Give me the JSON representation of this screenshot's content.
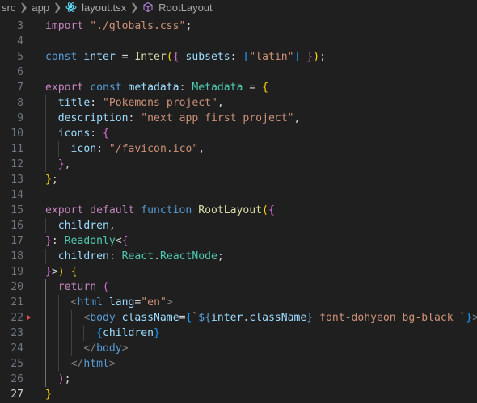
{
  "breadcrumb": {
    "items": [
      "src",
      "app",
      "layout.tsx",
      "RootLayout"
    ],
    "icons": [
      "chevron-right-icon",
      "react-icon",
      "symbol-method-icon"
    ]
  },
  "editor": {
    "active_line": "27",
    "lines": [
      {
        "n": "3",
        "tokens": [
          [
            "ctl",
            "import "
          ],
          [
            "str",
            "\"./globals.css\""
          ],
          [
            "txt",
            ";"
          ]
        ]
      },
      {
        "n": "4",
        "tokens": []
      },
      {
        "n": "5",
        "tokens": [
          [
            "kw",
            "const "
          ],
          [
            "var",
            "inter"
          ],
          [
            "txt",
            " = "
          ],
          [
            "fn",
            "Inter"
          ],
          [
            "b1",
            "("
          ],
          [
            "b2",
            "{"
          ],
          [
            "txt",
            " "
          ],
          [
            "var",
            "subsets"
          ],
          [
            "txt",
            ": "
          ],
          [
            "b3",
            "["
          ],
          [
            "str",
            "\"latin\""
          ],
          [
            "b3",
            "]"
          ],
          [
            "txt",
            " "
          ],
          [
            "b2",
            "}"
          ],
          [
            "b1",
            ")"
          ],
          [
            "txt",
            ";"
          ]
        ]
      },
      {
        "n": "6",
        "tokens": []
      },
      {
        "n": "7",
        "tokens": [
          [
            "ctl",
            "export "
          ],
          [
            "kw",
            "const "
          ],
          [
            "var",
            "metadata"
          ],
          [
            "txt",
            ": "
          ],
          [
            "cls",
            "Metadata"
          ],
          [
            "txt",
            " = "
          ],
          [
            "b1",
            "{"
          ]
        ]
      },
      {
        "n": "8",
        "tokens": [
          [
            "txt",
            "  "
          ],
          [
            "var",
            "title"
          ],
          [
            "txt",
            ": "
          ],
          [
            "str",
            "\"Pokemons project\""
          ],
          [
            "txt",
            ","
          ]
        ]
      },
      {
        "n": "9",
        "tokens": [
          [
            "txt",
            "  "
          ],
          [
            "var",
            "description"
          ],
          [
            "txt",
            ": "
          ],
          [
            "str",
            "\"next app first project\""
          ],
          [
            "txt",
            ","
          ]
        ]
      },
      {
        "n": "10",
        "tokens": [
          [
            "txt",
            "  "
          ],
          [
            "var",
            "icons"
          ],
          [
            "txt",
            ": "
          ],
          [
            "b2",
            "{"
          ]
        ]
      },
      {
        "n": "11",
        "tokens": [
          [
            "txt",
            "    "
          ],
          [
            "var",
            "icon"
          ],
          [
            "txt",
            ": "
          ],
          [
            "str",
            "\"/favicon.ico\""
          ],
          [
            "txt",
            ","
          ]
        ]
      },
      {
        "n": "12",
        "tokens": [
          [
            "txt",
            "  "
          ],
          [
            "b2",
            "}"
          ],
          [
            "txt",
            ","
          ]
        ]
      },
      {
        "n": "13",
        "tokens": [
          [
            "b1",
            "}"
          ],
          [
            "txt",
            ";"
          ]
        ]
      },
      {
        "n": "14",
        "tokens": []
      },
      {
        "n": "15",
        "tokens": [
          [
            "ctl",
            "export default "
          ],
          [
            "kw",
            "function "
          ],
          [
            "fn",
            "RootLayout"
          ],
          [
            "b1",
            "("
          ],
          [
            "b2",
            "{"
          ]
        ]
      },
      {
        "n": "16",
        "tokens": [
          [
            "txt",
            "  "
          ],
          [
            "var",
            "children"
          ],
          [
            "txt",
            ","
          ]
        ]
      },
      {
        "n": "17",
        "tokens": [
          [
            "b2",
            "}"
          ],
          [
            "txt",
            ": "
          ],
          [
            "cls",
            "Readonly"
          ],
          [
            "txt",
            "<"
          ],
          [
            "b2",
            "{"
          ]
        ]
      },
      {
        "n": "18",
        "tokens": [
          [
            "txt",
            "  "
          ],
          [
            "var",
            "children"
          ],
          [
            "txt",
            ": "
          ],
          [
            "cls",
            "React"
          ],
          [
            "txt",
            "."
          ],
          [
            "cls",
            "ReactNode"
          ],
          [
            "txt",
            ";"
          ]
        ]
      },
      {
        "n": "19",
        "tokens": [
          [
            "b2",
            "}"
          ],
          [
            "txt",
            ">"
          ],
          [
            "b1",
            ")"
          ],
          [
            "txt",
            " "
          ],
          [
            "b1",
            "{"
          ]
        ]
      },
      {
        "n": "20",
        "tokens": [
          [
            "txt",
            "  "
          ],
          [
            "ctl",
            "return "
          ],
          [
            "b2",
            "("
          ]
        ]
      },
      {
        "n": "21",
        "tokens": [
          [
            "txt",
            "    "
          ],
          [
            "ang",
            "<"
          ],
          [
            "tag",
            "html "
          ],
          [
            "var",
            "lang"
          ],
          [
            "txt",
            "="
          ],
          [
            "str",
            "\"en\""
          ],
          [
            "ang",
            ">"
          ]
        ]
      },
      {
        "n": "22",
        "tokens": [
          [
            "txt",
            "      "
          ],
          [
            "ang",
            "<"
          ],
          [
            "tag",
            "body "
          ],
          [
            "var",
            "className"
          ],
          [
            "txt",
            "="
          ],
          [
            "b3",
            "{"
          ],
          [
            "str",
            "`"
          ],
          [
            "kw",
            "${"
          ],
          [
            "var",
            "inter"
          ],
          [
            "txt",
            "."
          ],
          [
            "var",
            "className"
          ],
          [
            "kw",
            "}"
          ],
          [
            "str",
            " font-dohyeon bg-black `"
          ],
          [
            "b3",
            "}"
          ],
          [
            "ang",
            ">"
          ]
        ]
      },
      {
        "n": "23",
        "tokens": [
          [
            "txt",
            "        "
          ],
          [
            "b3",
            "{"
          ],
          [
            "var",
            "children"
          ],
          [
            "b3",
            "}"
          ]
        ]
      },
      {
        "n": "24",
        "tokens": [
          [
            "txt",
            "      "
          ],
          [
            "ang",
            "</"
          ],
          [
            "tag",
            "body"
          ],
          [
            "ang",
            ">"
          ]
        ]
      },
      {
        "n": "25",
        "tokens": [
          [
            "txt",
            "    "
          ],
          [
            "ang",
            "</"
          ],
          [
            "tag",
            "html"
          ],
          [
            "ang",
            ">"
          ]
        ]
      },
      {
        "n": "26",
        "tokens": [
          [
            "txt",
            "  "
          ],
          [
            "b2",
            ")"
          ],
          [
            "txt",
            ";"
          ]
        ]
      },
      {
        "n": "27",
        "tokens": [
          [
            "b1",
            "}"
          ]
        ]
      }
    ]
  }
}
